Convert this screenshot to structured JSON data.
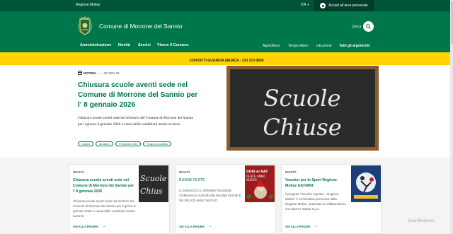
{
  "top_bar": {
    "region": "Regione Molise",
    "language": "ITA",
    "login": "Accedi all'area personale"
  },
  "header": {
    "title": "Comune di Morrone del Sannio",
    "search_label": "Cerca"
  },
  "nav": {
    "main": [
      "Amministrazione",
      "Novità",
      "Servizi",
      "Vivere il Comune"
    ],
    "secondary": [
      "Agricoltura",
      "Tempo libero",
      "Istruzione",
      "Tutti gli argomenti"
    ]
  },
  "alert": "CONTATTI GUARDIA MEDICA - 333 373 0805",
  "hero": {
    "type": "NOTIZIA",
    "date": "08 GEN 26",
    "title": "Chiusura scuole aventi sede nel Comune di Morrone del Sannio per l' 8 gennaio 2026",
    "lead": "Chiusura scuole aventi sede nel territorio del Comune di Morrone del Sannio per il giorno 8 gennaio 2026 a causa delle condizioni meteo avverse.",
    "tags": [
      "Cultura",
      "Istruzione",
      "Protezione civile",
      "Trasporto pubblico"
    ],
    "image_text": [
      "Scuole",
      "Chiuse"
    ]
  },
  "cards": [
    {
      "category": "NOVITÀ",
      "title": "Chiusura scuole aventi sede nel Comune di Morrone del Sannio per l' 8 gennaio 2026",
      "description": "Chiusura scuole aventi sede nel territorio del Comune di Morrone del Sannio per il giorno 8 gennaio 2026 a causa delle condizioni meteo avverse.",
      "link": "VAI ALLA PAGINA",
      "thumb_text": "Scuole Chius"
    },
    {
      "category": "NOVITÀ",
      "title": "BUONE FESTE",
      "description": "IL SINDACO E L'AMMINISTRAZIONE COMUNALE AUGURANO BUONE FESTE E UN FELICE ANNO NUOVO",
      "link": "VAI ALLA PAGINA",
      "thumb_text": "...GURI di NAT... FELICE ANNO NUOVO"
    },
    {
      "category": "NOVITÀ",
      "title": "Voucher per lo Sport Regione Molise GIOVANI",
      "description": "Il progetto \"Voucher Sportivi – Regione Molise\" è un'iniziativa promossa dalla Regione Molise, realizzata in collaborazione con Sport e Salute S.p.A.",
      "link": "VAI ALLA PAGINA"
    }
  ],
  "watermark": "ScanMalware",
  "colors": {
    "primary": "#00774a",
    "dark": "#00543a",
    "alert": "#ffd400"
  }
}
